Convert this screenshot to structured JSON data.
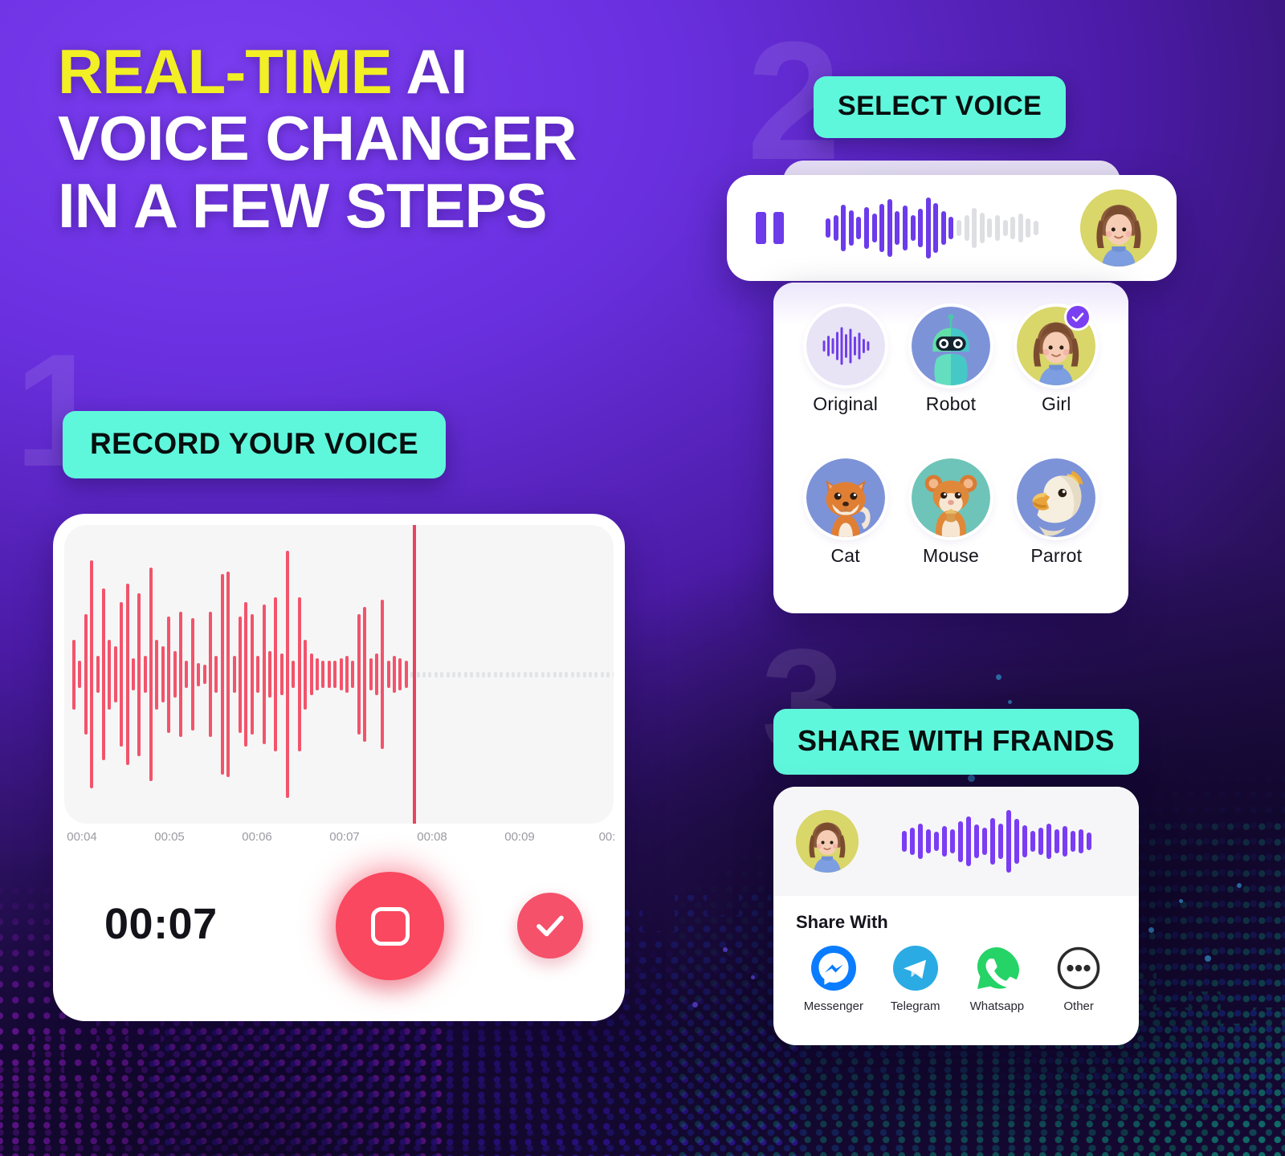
{
  "headline": {
    "line1_highlight": "REAL-TIME",
    "line1_rest": "AI",
    "line2": "VOICE CHANGER",
    "line3": "IN A FEW STEPS",
    "highlight_color": "#f2ef24"
  },
  "steps": {
    "one": "1",
    "two": "2",
    "three": "3"
  },
  "pills": {
    "record": "RECORD YOUR VOICE",
    "select": "SELECT VOICE",
    "share": "SHARE WITH FRANDS",
    "background_color": "#5ff7dc"
  },
  "recorder": {
    "timer": "00:07",
    "stop_label": "Stop",
    "confirm_label": "Done",
    "accent_color": "#f9485f",
    "axis_ticks": [
      "00:04",
      "00:05",
      "00:06",
      "00:07",
      "00:08",
      "00:09",
      "00:"
    ],
    "playhead_time": "00:07",
    "waveform": [
      30,
      12,
      52,
      98,
      16,
      74,
      30,
      24,
      62,
      78,
      14,
      70,
      16,
      92,
      30,
      24,
      50,
      20,
      54,
      12,
      48,
      10,
      8,
      54,
      16,
      86,
      88,
      16,
      50,
      62,
      52,
      16,
      60,
      20,
      66,
      18,
      106,
      12,
      66,
      30,
      18,
      14,
      12,
      12,
      12,
      14,
      16,
      12,
      52,
      58,
      14,
      18,
      64,
      12,
      16,
      14,
      12
    ],
    "waveform_tail_count": 60
  },
  "player": {
    "state": "playing",
    "pause_label": "Pause",
    "avatar_name": "Girl",
    "played_color": "#6c3bea",
    "remaining_color": "#dedfe2",
    "waveform": [
      22,
      30,
      54,
      40,
      26,
      48,
      34,
      56,
      66,
      38,
      52,
      30,
      44,
      70,
      58,
      38,
      26,
      18,
      30,
      46,
      36,
      22,
      30,
      18,
      26,
      34,
      22,
      16
    ],
    "played_count": 17
  },
  "voices": {
    "items": [
      {
        "label": "Original",
        "icon": "waveform-icon",
        "selected": false,
        "bg": "#e8e4f6"
      },
      {
        "label": "Robot",
        "icon": "robot-icon",
        "selected": false,
        "bg": "#7d93d8"
      },
      {
        "label": "Girl",
        "icon": "girl-icon",
        "selected": true,
        "bg": "#d9d66a"
      },
      {
        "label": "Cat",
        "icon": "cat-icon",
        "selected": false,
        "bg": "#7d93d8"
      },
      {
        "label": "Mouse",
        "icon": "mouse-icon",
        "selected": false,
        "bg": "#6ec4b8"
      },
      {
        "label": "Parrot",
        "icon": "parrot-icon",
        "selected": false,
        "bg": "#7d93d8"
      }
    ],
    "selected_color": "#7b3ff2"
  },
  "share": {
    "title": "Share With",
    "avatar_name": "Girl",
    "waveform": [
      26,
      34,
      44,
      30,
      24,
      38,
      30,
      50,
      60,
      42,
      34,
      56,
      44,
      76,
      54,
      40,
      26,
      34,
      44,
      30,
      38,
      26,
      30,
      22
    ],
    "apps": [
      {
        "label": "Messenger",
        "icon": "messenger-icon",
        "color": "#0a7cff"
      },
      {
        "label": "Telegram",
        "icon": "telegram-icon",
        "color": "#2aabe4"
      },
      {
        "label": "Whatsapp",
        "icon": "whatsapp-icon",
        "color": "#25d366"
      },
      {
        "label": "Other",
        "icon": "more-dots-icon",
        "color": "#2b2b2b"
      }
    ]
  }
}
